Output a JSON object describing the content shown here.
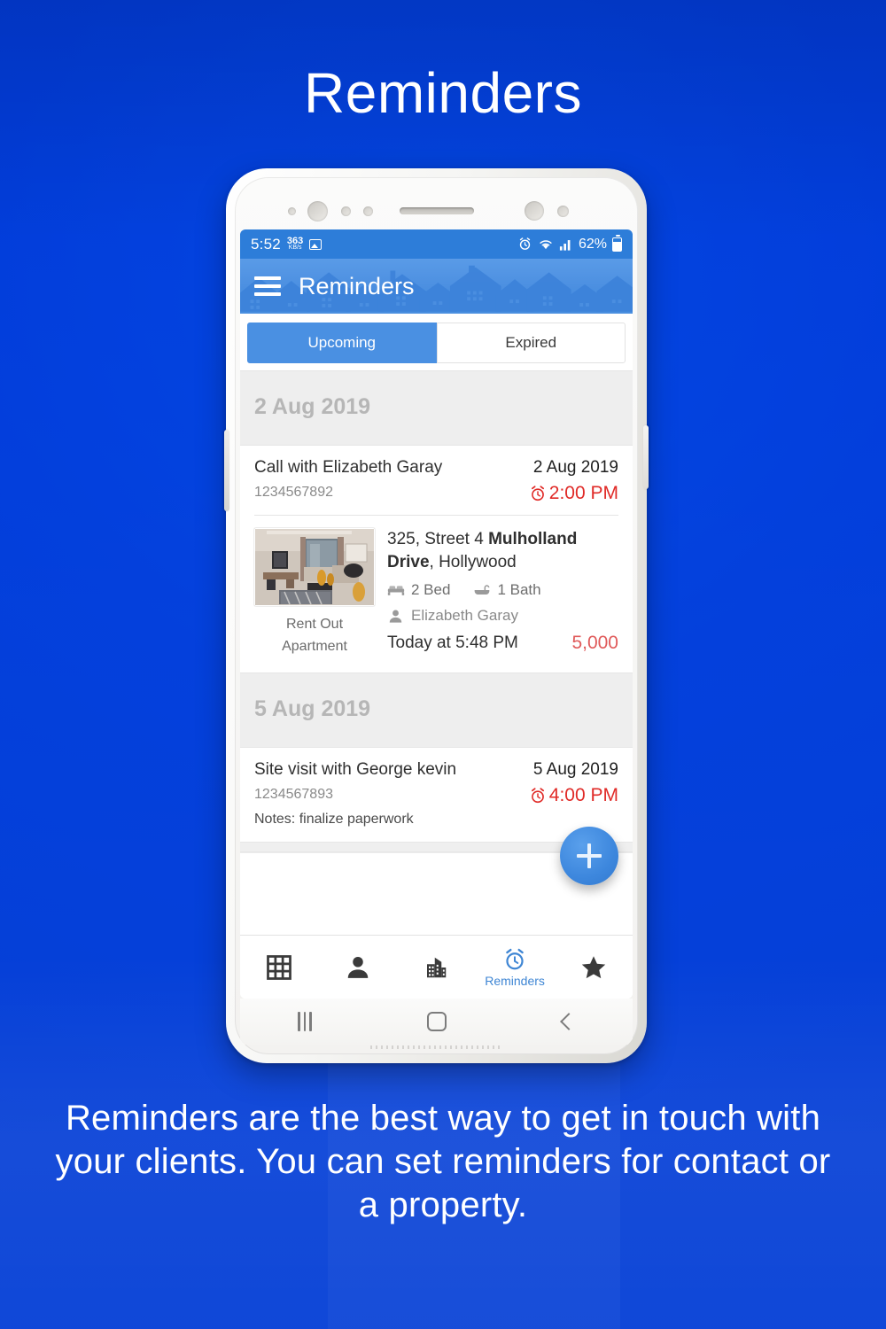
{
  "headline": "Reminders",
  "caption": "Reminders are the best way to get in touch with your clients. You can set reminders for contact or a property.",
  "colors": {
    "page_background": "#1259bc",
    "appbar": "#4a8fe0",
    "statusbar": "#2d7dd9",
    "accent_blue": "#4a90e2",
    "alarm_red": "#e02a27",
    "price_red": "#e05a5a",
    "section_grey": "#b6b6b6"
  },
  "phone": {
    "statusbar": {
      "time": "5:52",
      "network_speed_value": "363",
      "network_speed_unit": "KB/s",
      "image_icon": "image-icon",
      "alarm_icon": "alarm-icon",
      "wifi_icon": "wifi-icon",
      "signal_icon": "signal-bars-icon",
      "battery_percent": "62%",
      "battery_icon": "battery-icon"
    },
    "appbar": {
      "menu_icon": "hamburger-menu-icon",
      "title": "Reminders"
    },
    "tabs": [
      {
        "label": "Upcoming",
        "active": true
      },
      {
        "label": "Expired",
        "active": false
      }
    ],
    "sections": [
      {
        "date_header": "2 Aug 2019",
        "reminder": {
          "title": "Call with Elizabeth Garay",
          "phone": "1234567892",
          "date": "2 Aug 2019",
          "time": "2:00 PM",
          "time_icon": "alarm-clock-icon"
        },
        "property": {
          "thumbnail": "apartment-interior-photo",
          "deal_type": "Rent Out",
          "property_type": "Apartment",
          "address_prefix": "325, Street 4 ",
          "address_bold": "Mulholland Drive",
          "address_suffix": ", Hollywood",
          "beds": "2 Bed",
          "beds_icon": "bed-icon",
          "baths": "1 Bath",
          "baths_icon": "bathtub-icon",
          "owner": "Elizabeth Garay",
          "owner_icon": "person-icon",
          "updated": "Today at 5:48 PM",
          "price": "5,000"
        }
      },
      {
        "date_header": "5 Aug 2019",
        "reminder": {
          "title": "Site visit with George kevin",
          "phone": "1234567893",
          "notes": "Notes: finalize paperwork",
          "date": "5 Aug 2019",
          "time": "4:00 PM",
          "time_icon": "alarm-clock-icon"
        }
      }
    ],
    "fab": {
      "icon": "plus-icon",
      "label": "+"
    },
    "bottom_nav": [
      {
        "icon": "grid-icon",
        "label": "",
        "active": false
      },
      {
        "icon": "person-icon",
        "label": "",
        "active": false
      },
      {
        "icon": "building-icon",
        "label": "",
        "active": false
      },
      {
        "icon": "alarm-clock-icon",
        "label": "Reminders",
        "active": true
      },
      {
        "icon": "star-icon",
        "label": "",
        "active": false
      }
    ],
    "system_nav": [
      {
        "icon": "recents-icon"
      },
      {
        "icon": "home-icon"
      },
      {
        "icon": "back-icon"
      }
    ]
  }
}
